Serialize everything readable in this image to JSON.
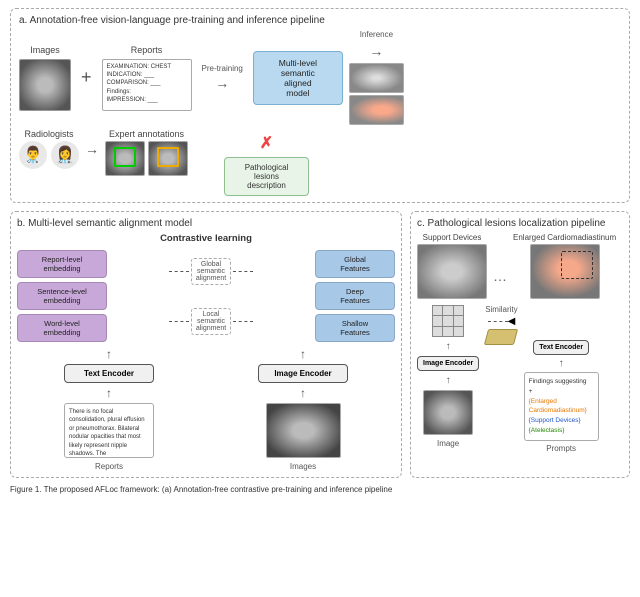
{
  "section_a": {
    "label": "a. Annotation-free vision-language pre-training and inference pipeline",
    "images_label": "Images",
    "reports_label": "Reports",
    "pretrain_label": "Pre-training",
    "inference_label": "Inference",
    "model_label": "Multi-level\nsemantic\naligned\nmodel",
    "pathological_label": "Pathological\nlesions\ndescription",
    "radiologists_label": "Radiologists",
    "expert_label": "Expert annotations",
    "report_lines": [
      "EXAMINATION: CHEST",
      "INDICATION: ___",
      "COMPARISON: ___",
      "Findings:",
      "IMPRESSION: ___"
    ]
  },
  "section_b": {
    "label": "b. Multi-level semantic alignment model",
    "contrastive_header": "Contrastive learning",
    "embeddings": [
      {
        "text": "Report-level\nembedding"
      },
      {
        "text": "Sentence-level\nembedding"
      },
      {
        "text": "Word-level\nembedding"
      }
    ],
    "alignments": [
      {
        "text": "Global\nsemantic\nalignment"
      },
      {
        "text": "Local\nsemantic\nalignment"
      }
    ],
    "features": [
      {
        "text": "Global\nFeatures"
      },
      {
        "text": "Deep\nFeatures"
      },
      {
        "text": "Shallow\nFeatures"
      }
    ],
    "text_encoder_label": "Text Encoder",
    "image_encoder_label": "Image Encoder",
    "reports_label": "Reports",
    "images_label": "Images",
    "report_text": "There is no focal consolidation, plural effusion or pneumothorax. Bilateral nodular opacities that most likely represent nipple shadows. The cardiomadiastinal silhouette is normal. Clips project over the left lung, potentially within the breast."
  },
  "section_c": {
    "label": "c. Pathological lesions localization pipeline",
    "support_label": "Support Devices",
    "enlarged_label": "Enlarged Cardiomadiastinum",
    "image_label": "Image",
    "similarity_label": "Similarity",
    "image_encoder_label": "Image Encoder",
    "text_encoder_label": "Text Encoder",
    "prompts_label": "Prompts",
    "findings_prefix": "Findings suggesting",
    "prompt1": "Enlarged Cardiomadiastinum",
    "prompt2": "Support Devices",
    "prompt3": "Atelectasis",
    "plus": "+"
  },
  "caption": {
    "text": "Figure 1. The proposed AFLoc framework: (a) Annotation-free contrastive pre-training and inference pipeline"
  }
}
